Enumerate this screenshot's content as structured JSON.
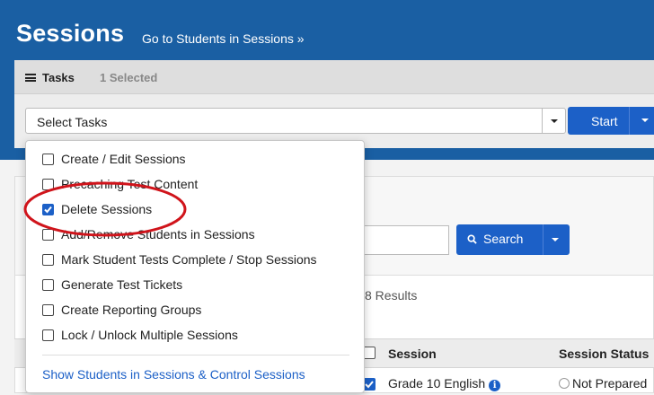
{
  "header": {
    "title": "Sessions",
    "link": "Go to Students in Sessions »"
  },
  "tasks": {
    "label": "Tasks",
    "selected_count": "1 Selected",
    "select_placeholder": "Select Tasks",
    "start_label": "Start"
  },
  "menu": {
    "items": [
      {
        "label": "Create / Edit Sessions",
        "checked": false
      },
      {
        "label": "Precaching Test Content",
        "checked": false
      },
      {
        "label": "Delete Sessions",
        "checked": true
      },
      {
        "label": "Add/Remove Students in Sessions",
        "checked": false
      },
      {
        "label": "Mark Student Tests Complete / Stop Sessions",
        "checked": false
      },
      {
        "label": "Generate Test Tickets",
        "checked": false
      },
      {
        "label": "Create Reporting Groups",
        "checked": false
      },
      {
        "label": "Lock / Unlock Multiple Sessions",
        "checked": false
      }
    ],
    "footer_link": "Show Students in Sessions & Control Sessions"
  },
  "search": {
    "button_label": "Search"
  },
  "results": {
    "count_text": "8 Results",
    "columns": [
      "Session",
      "Session Status"
    ],
    "rows": [
      {
        "session": "Grade 10 English",
        "status": "Not Prepared",
        "checked": true
      }
    ]
  },
  "colors": {
    "header_bg": "#1a5fa3",
    "accent": "#1c60c7",
    "annotation": "#d0141b"
  },
  "icons": {
    "tasks": "list-icon",
    "search": "search-icon",
    "info": "info-icon"
  }
}
